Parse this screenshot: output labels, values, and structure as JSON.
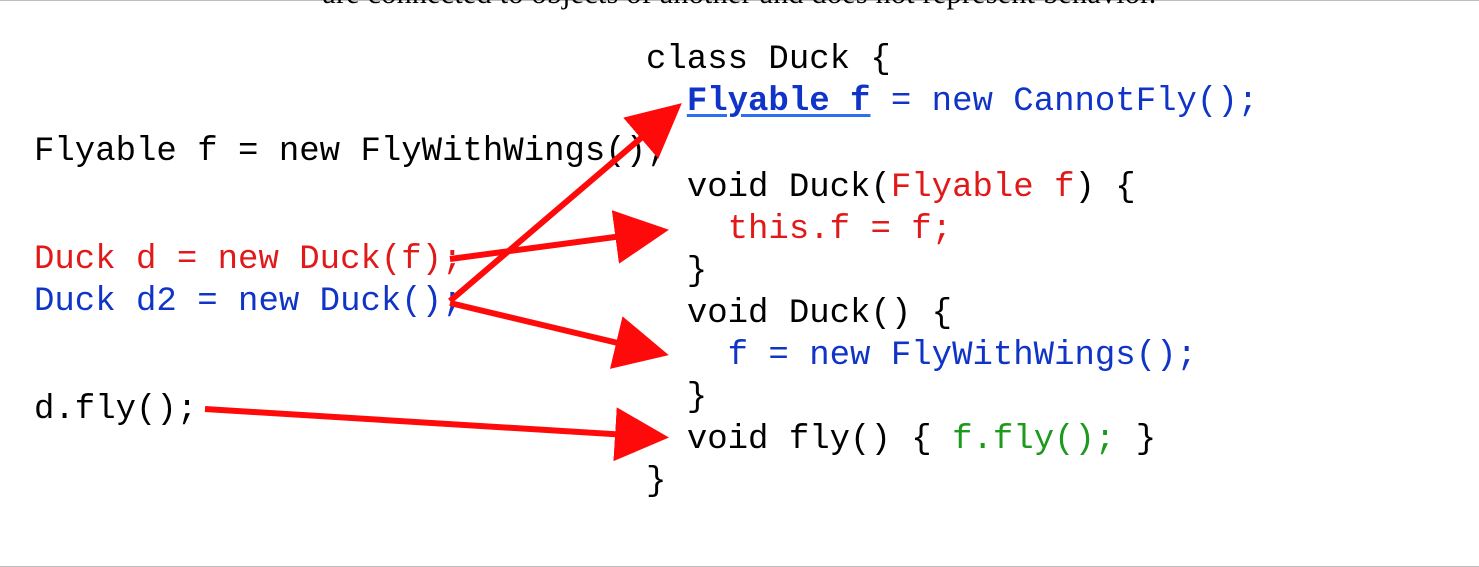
{
  "fragment_line": "are connected to objects of another and does not represent behavior.",
  "left": {
    "l1": {
      "a": "Flyable f = ",
      "b": "new",
      "c": " FlyWithWings();"
    },
    "l2": {
      "a": "Duck d = ",
      "b": "new",
      "c": " Duck(f);"
    },
    "l3": {
      "a": "Duck d2 = ",
      "b": "new",
      "c": " Duck();"
    },
    "l4": "d.fly();"
  },
  "right": {
    "r1": "class Duck {",
    "r2": {
      "a": "  ",
      "b": "Flyable f",
      "c": " = ",
      "d": "new",
      "e": " CannotFly();"
    },
    "r3": "",
    "r4": {
      "a": "  ",
      "b": "void",
      "c": " Duck(",
      "d": "Flyable f",
      "e": ") {"
    },
    "r5": {
      "a": "    ",
      "b": "this",
      "c": ".f = f;"
    },
    "r6": "  }",
    "r7": {
      "a": "  ",
      "b": "void",
      "c": " Duck() {"
    },
    "r8": {
      "a": "    f = ",
      "b": "new",
      "c": " FlyWithWings();"
    },
    "r9": "  }",
    "r10": {
      "a": "  ",
      "b": "void",
      "c": " fly() { ",
      "d": "f.fly();",
      "e": " }"
    },
    "r11": "}"
  },
  "colors": {
    "arrow": "#ff0a0a"
  }
}
